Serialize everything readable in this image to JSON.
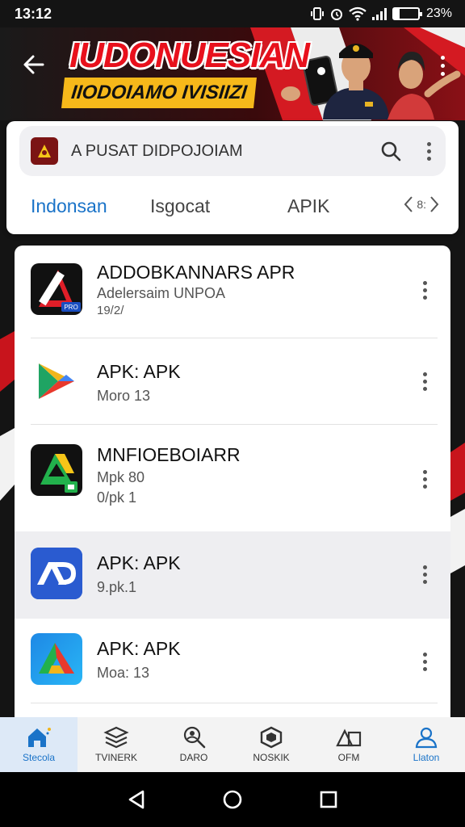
{
  "status": {
    "time": "13:12",
    "battery": "23%",
    "battery_level": 0.23
  },
  "banner": {
    "title": "IUDONUESIAN",
    "subtitle": "IIODOIAMO IVISIIZI"
  },
  "search": {
    "placeholder": "A PUSAT DIDPOJOIAM"
  },
  "tabs": [
    {
      "label": "Indonsan",
      "active": true
    },
    {
      "label": "Isgocat",
      "active": false
    },
    {
      "label": "APIK",
      "active": false
    }
  ],
  "tab_pager": "8:",
  "apps": [
    {
      "name": "ADDOBKANNARS APR",
      "sub1": "Adelersaim UNPOA",
      "sub2": "19/2/",
      "icon": "red-triangle-app-icon",
      "badge": "PRO"
    },
    {
      "name": "APK: APK",
      "sub1": "Moro 13",
      "sub2": "",
      "icon": "play-store-icon"
    },
    {
      "name": "MNFIOEBOIARR",
      "sub1": "Mpk 80",
      "sub2": "0/pk 1",
      "icon": "green-drive-app-icon"
    },
    {
      "name": "APK: APK",
      "sub1": "9.pk.1",
      "sub2": "",
      "icon": "ap-blue-app-icon"
    },
    {
      "name": "APK: APK",
      "sub1": "Moa: 13",
      "sub2": "",
      "icon": "triangle-gradient-app-icon"
    }
  ],
  "bottom_nav": [
    {
      "label": "Stecola",
      "icon": "home-icon",
      "active": true
    },
    {
      "label": "TVINERK",
      "icon": "stack-icon",
      "active": false
    },
    {
      "label": "DARO",
      "icon": "search-person-icon",
      "active": false
    },
    {
      "label": "NOSKIK",
      "icon": "hexagon-icon",
      "active": false
    },
    {
      "label": "OFM",
      "icon": "shapes-icon",
      "active": false
    },
    {
      "label": "Llaton",
      "icon": "account-icon",
      "active": false
    }
  ],
  "colors": {
    "accent": "#1a73c8",
    "banner_red": "#e8101c",
    "banner_yellow": "#f6b81a"
  }
}
